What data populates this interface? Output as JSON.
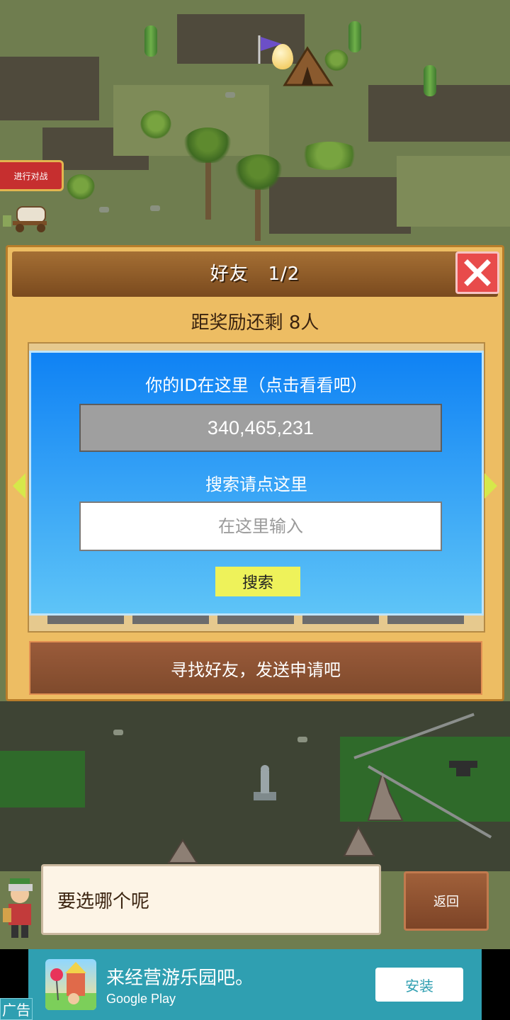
{
  "map": {
    "battle_button": "进行对战"
  },
  "dialog": {
    "title": "好友",
    "page": "1/2",
    "reward_text": "距奖励还剩 8人",
    "id_caption": "你的ID在这里（点击看看吧）",
    "id_value": "340,465,231",
    "search_caption": "搜索请点这里",
    "search_placeholder": "在这里输入",
    "search_button": "搜索",
    "find_friends_button": "寻找好友，发送申请吧"
  },
  "chat": {
    "message": "要选哪个呢",
    "back_button": "返回"
  },
  "ad": {
    "label": "广告",
    "title": "来经营游乐园吧。",
    "subtitle": "Google Play",
    "install_button": "安装"
  },
  "colors": {
    "panel_blue": "#0f82f4",
    "close_red": "#e84b4b",
    "search_yellow": "#eef25a",
    "ad_teal": "#2f9fb1"
  }
}
